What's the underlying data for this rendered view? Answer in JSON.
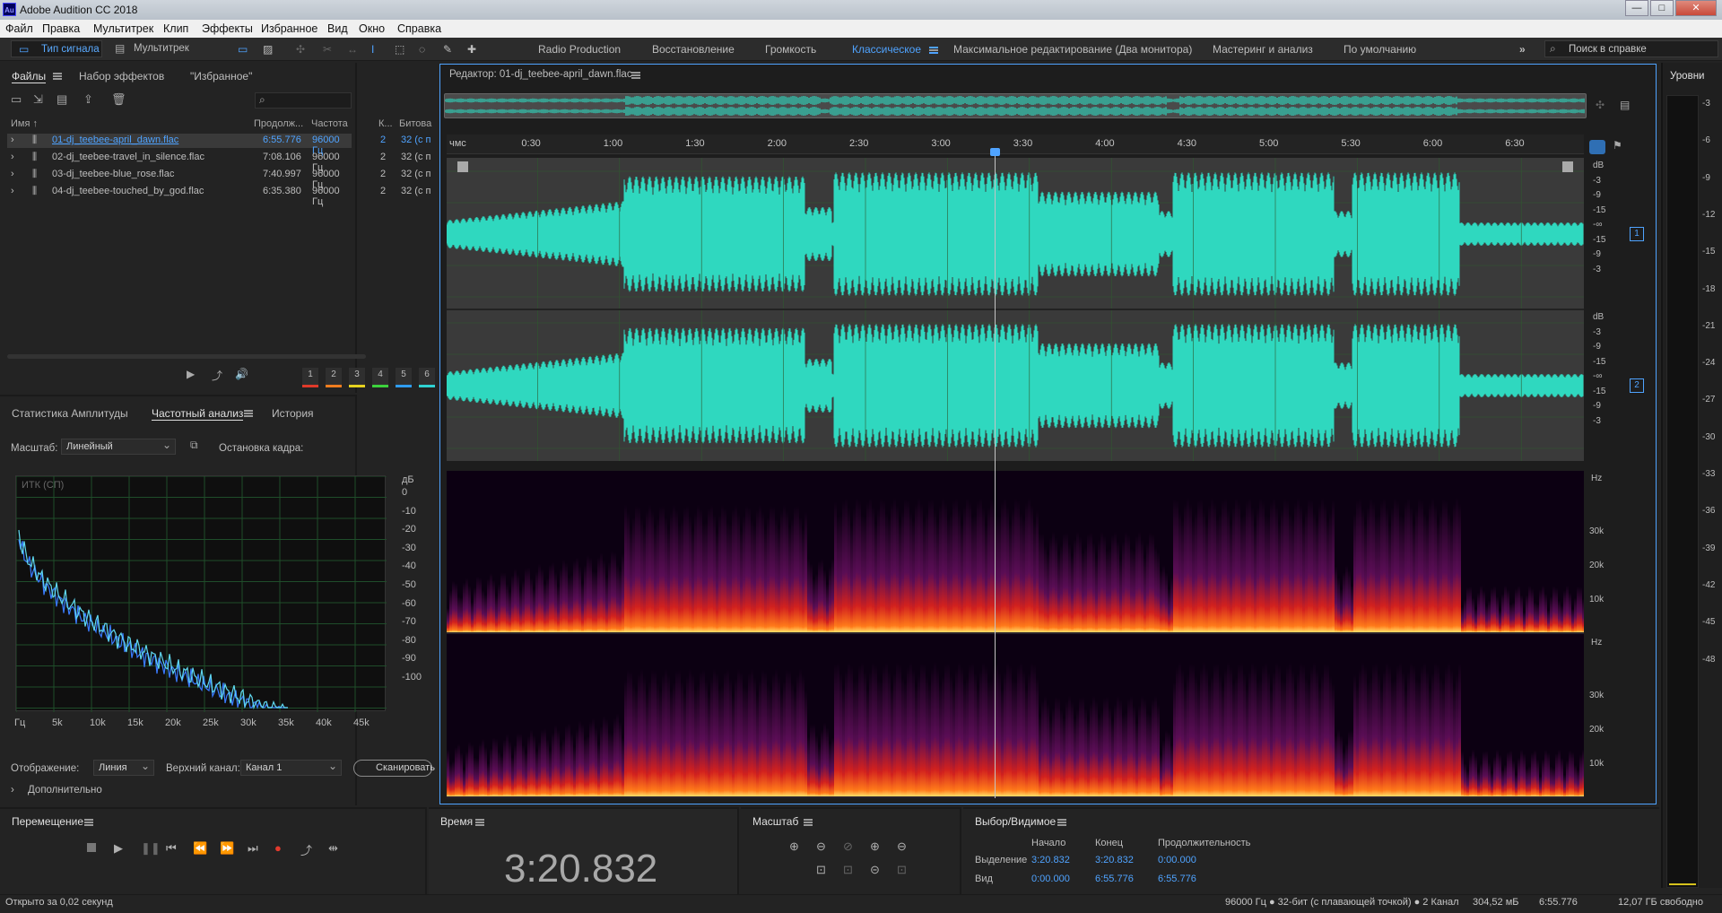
{
  "app": {
    "title": "Adobe Audition CC 2018",
    "logo": "Au"
  },
  "window_buttons": {
    "minimize": "—",
    "maximize": "□",
    "close": "✕"
  },
  "menu": [
    "Файл",
    "Правка",
    "Мультитрек",
    "Клип",
    "Эффекты",
    "Избранное",
    "Вид",
    "Окно",
    "Справка"
  ],
  "toolbar": {
    "waveform_label": "Тип сигнала",
    "multitrack_label": "Мультитрек"
  },
  "workspaces": [
    "Radio Production",
    "Восстановление",
    "Громкость",
    "Классическое",
    "Максимальное редактирование (Два монитора)",
    "Мастеринг и анализ",
    "По умолчанию"
  ],
  "active_workspace": "Классическое",
  "search": {
    "placeholder": "Поиск в справке"
  },
  "files_panel": {
    "tabs": [
      "Файлы",
      "Набор эффектов",
      "\"Избранное\""
    ],
    "columns": [
      "Имя ↑",
      "Продолж...",
      "Частота",
      "К...",
      "Битова"
    ],
    "rows": [
      {
        "name": "01-dj_teebee-april_dawn.flac",
        "duration": "6:55.776",
        "rate": "96000 Гц",
        "ch": "2",
        "bits": "32 (с п"
      },
      {
        "name": "02-dj_teebee-travel_in_silence.flac",
        "duration": "7:08.106",
        "rate": "96000 Гц",
        "ch": "2",
        "bits": "32 (с п"
      },
      {
        "name": "03-dj_teebee-blue_rose.flac",
        "duration": "7:40.997",
        "rate": "96000 Гц",
        "ch": "2",
        "bits": "32 (с п"
      },
      {
        "name": "04-dj_teebee-touched_by_god.flac",
        "duration": "6:35.380",
        "rate": "96000 Гц",
        "ch": "2",
        "bits": "32 (с п"
      }
    ]
  },
  "analysis_panel": {
    "tabs": [
      "Статистика Амплитуды",
      "Частотный анализ",
      "История"
    ],
    "scale_label": "Масштаб:",
    "scale_value": "Линейный",
    "freeze_label": "Остановка кадра:",
    "freeze_slots": [
      {
        "n": "1",
        "color": "#e03a2a"
      },
      {
        "n": "2",
        "color": "#f07d1f"
      },
      {
        "n": "3",
        "color": "#e6d21f"
      },
      {
        "n": "4",
        "color": "#3cd23c"
      },
      {
        "n": "5",
        "color": "#2f9cf0"
      },
      {
        "n": "6",
        "color": "#2fd2d2"
      }
    ],
    "graph_label": "ИТК (СП)",
    "db_unit": "дБ",
    "db_ticks": [
      "0",
      "-10",
      "-20",
      "-30",
      "-40",
      "-50",
      "-60",
      "-70",
      "-80",
      "-90",
      "-100"
    ],
    "hz_ticks": [
      "Гц",
      "5k",
      "10k",
      "15k",
      "20k",
      "25k",
      "30k",
      "35k",
      "40k",
      "45k"
    ],
    "display_label": "Отображение:",
    "display_value": "Линия",
    "upper_channel_label": "Верхний канал:",
    "upper_channel_value": "Канал 1",
    "scan_button": "Сканировать",
    "advanced": "Дополнительно"
  },
  "editor": {
    "title": "Редактор: 01-dj_teebee-april_dawn.flac",
    "ruler": [
      "чмс",
      "0:30",
      "1:00",
      "1:30",
      "2:00",
      "2:30",
      "3:00",
      "3:30",
      "4:00",
      "4:30",
      "5:00",
      "5:30",
      "6:00",
      "6:30"
    ],
    "db_scale": [
      "dB",
      "-3",
      "-9",
      "-15",
      "-∞",
      "-15",
      "-9",
      "-3"
    ],
    "channel_badges": [
      "1",
      "2"
    ],
    "hz_unit": "Hz",
    "hz_scale": [
      "30k",
      "20k",
      "10k"
    ],
    "waveform_color": "#2fd8bf"
  },
  "levels": {
    "title": "Уровни",
    "ticks": [
      "-3",
      "-6",
      "-9",
      "-12",
      "-15",
      "-18",
      "-21",
      "-24",
      "-27",
      "-30",
      "-33",
      "-36",
      "-39",
      "-42",
      "-45",
      "-48"
    ]
  },
  "transport": {
    "title": "Перемещение",
    "buttons": [
      "stop",
      "play",
      "pause",
      "to-start",
      "rewind",
      "forward",
      "to-end",
      "record",
      "loop",
      "skip"
    ]
  },
  "time": {
    "title": "Время",
    "value": "3:20.832"
  },
  "zoom": {
    "title": "Масштаб"
  },
  "selection": {
    "title": "Выбор/Видимое",
    "col_headers": [
      "Начало",
      "Конец",
      "Продолжительность"
    ],
    "rows": [
      {
        "label": "Выделение",
        "start": "3:20.832",
        "end": "3:20.832",
        "duration": "0:00.000"
      },
      {
        "label": "Вид",
        "start": "0:00.000",
        "end": "6:55.776",
        "duration": "6:55.776"
      }
    ]
  },
  "status": {
    "left": "Открыто за 0,02 секунд",
    "format": "96000 Гц ● 32-бит (с плавающей точкой) ● 2 Канал",
    "size": "304,52 мБ",
    "duration": "6:55.776",
    "free": "12,07 ГБ свободно"
  }
}
